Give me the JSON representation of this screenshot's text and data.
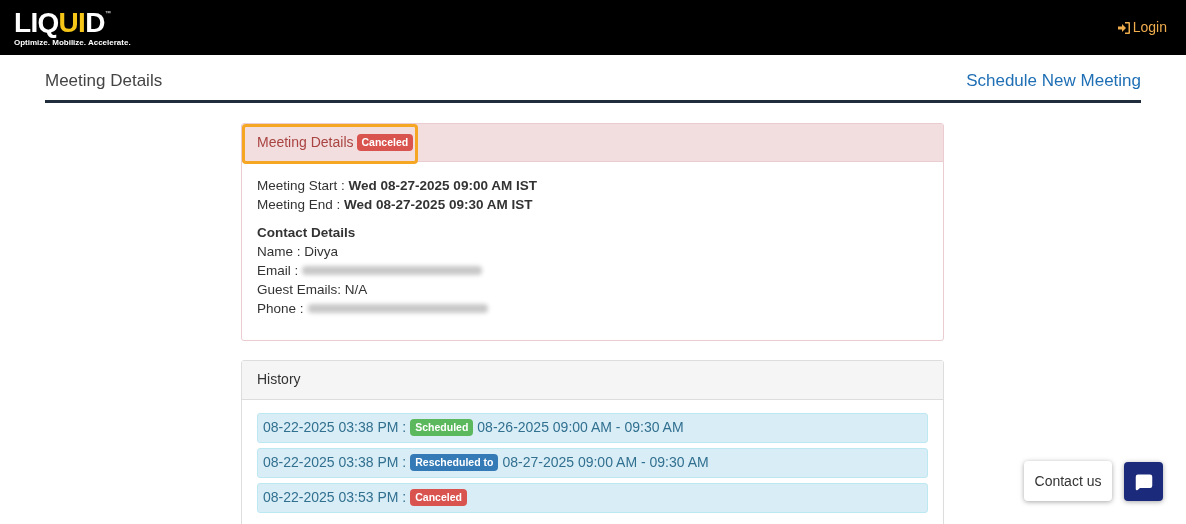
{
  "header": {
    "logo": {
      "parts": [
        {
          "text": "LIQ",
          "highlight": false
        },
        {
          "text": "UI",
          "highlight": true
        },
        {
          "text": "D",
          "highlight": false
        }
      ],
      "mark": "™",
      "tagline": "Optimize. Mobilize. Accelerate."
    },
    "login": "Login"
  },
  "nav": {
    "title": "Meeting Details",
    "link": "Schedule New Meeting"
  },
  "meeting": {
    "title": "Meeting Details",
    "highlighted": true,
    "status": {
      "label": "Canceled",
      "kind": "danger"
    },
    "times": [
      {
        "label": "Meeting Start :",
        "value": "Wed 08-27-2025 09:00 AM IST"
      },
      {
        "label": "Meeting End :",
        "value": "Wed 08-27-2025 09:30 AM IST"
      }
    ],
    "contact_title": "Contact Details",
    "contact": [
      {
        "label": "Name :",
        "value": "Divya",
        "redacted": false
      },
      {
        "label": "Email :",
        "redacted": true
      },
      {
        "label": "Guest Emails:",
        "value": "N/A",
        "redacted": false
      },
      {
        "label": "Phone :",
        "redacted": true
      }
    ]
  },
  "history": {
    "title": "History",
    "entries": [
      {
        "time": "08-22-2025 03:38 PM :",
        "badge": {
          "label": "Scheduled",
          "kind": "success"
        },
        "detail": "08-26-2025 09:00 AM - 09:30 AM"
      },
      {
        "time": "08-22-2025 03:38 PM :",
        "badge": {
          "label": "Rescheduled to",
          "kind": "primary"
        },
        "detail": "08-27-2025 09:00 AM - 09:30 AM"
      },
      {
        "time": "08-22-2025 03:53 PM :",
        "badge": {
          "label": "Canceled",
          "kind": "danger"
        }
      }
    ]
  },
  "contact_button": "Contact us"
}
